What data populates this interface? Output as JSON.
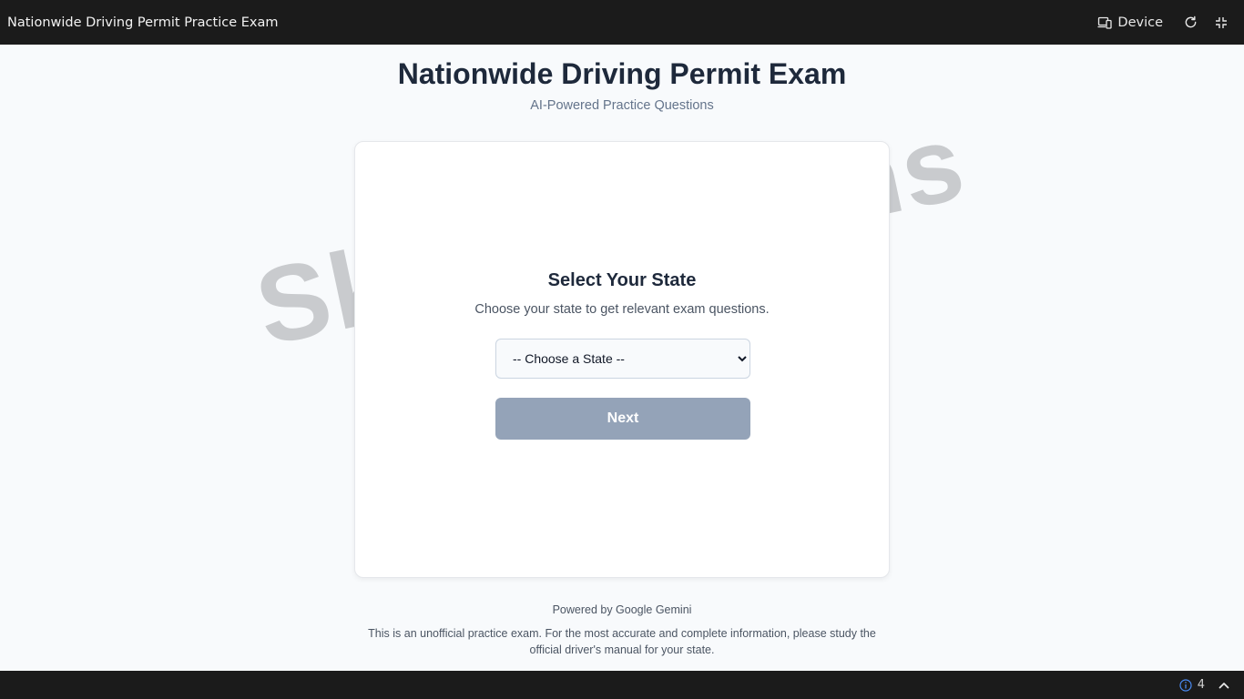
{
  "topbar": {
    "title": "Nationwide Driving Permit Practice Exam",
    "device_label": "Device",
    "icons": [
      "device-icon",
      "refresh-icon",
      "fullscreen-exit-icon"
    ]
  },
  "header": {
    "title": "Nationwide Driving Permit Exam",
    "subtitle": "AI-Powered Practice Questions"
  },
  "card": {
    "title": "Select Your State",
    "description": "Choose your state to get relevant exam questions.",
    "select": {
      "selected": "-- Choose a State --"
    },
    "next_label": "Next"
  },
  "footer": {
    "powered_by": "Powered by Google Gemini",
    "disclaimer": "This is an unofficial practice exam. For the most accurate and complete information, please study the official driver's manual for your state."
  },
  "bottombar": {
    "info_count": "4",
    "icons": [
      "info-icon",
      "chevron-up-icon"
    ]
  },
  "colors": {
    "topbar_bg": "#1b1b1b",
    "page_bg": "#f8fafc",
    "title_text": "#1e293b",
    "button_disabled": "#94a3b8",
    "info_blue": "#4a8bf5"
  }
}
